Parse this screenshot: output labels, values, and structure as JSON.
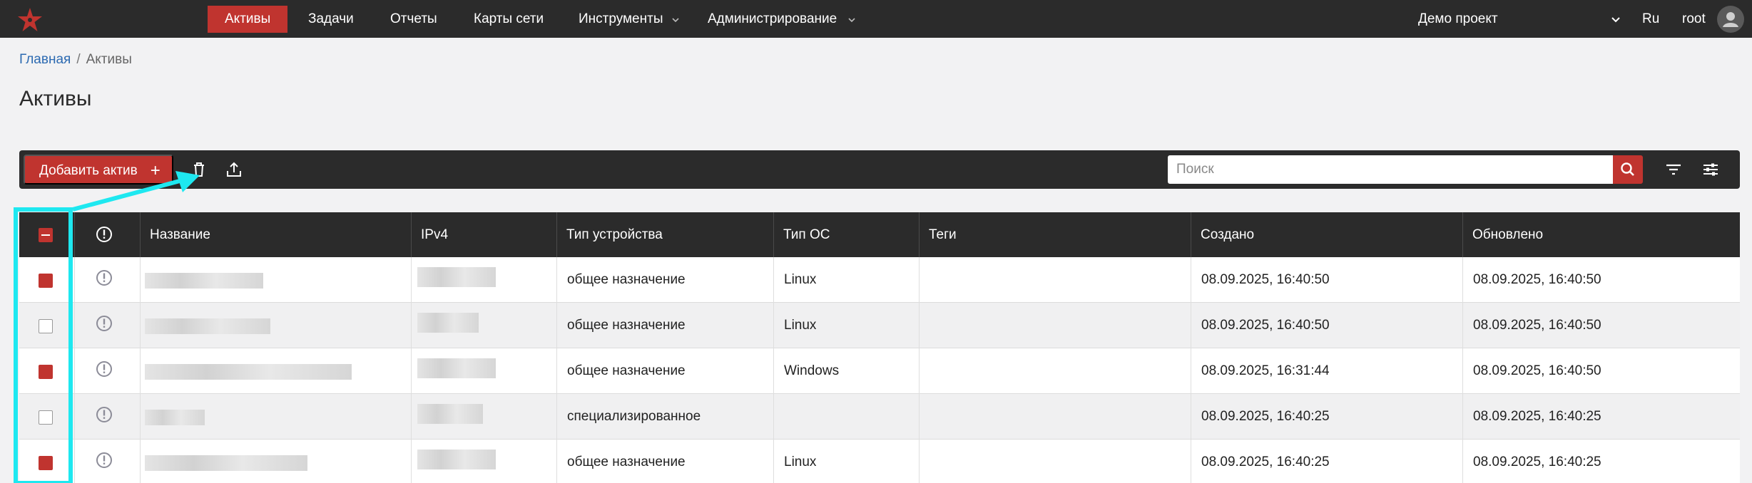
{
  "nav": {
    "items": [
      {
        "label": "Активы",
        "active": true
      },
      {
        "label": "Задачи"
      },
      {
        "label": "Отчеты"
      },
      {
        "label": "Карты сети"
      },
      {
        "label": "Инструменты",
        "dropdown": true
      },
      {
        "label": "Администрирование",
        "dropdown": true
      }
    ],
    "project": "Демо проект",
    "lang": "Ru",
    "user": "root"
  },
  "breadcrumb": {
    "home": "Главная",
    "separator": "/",
    "current": "Активы"
  },
  "page_title": "Активы",
  "toolbar": {
    "add_label": "Добавить актив",
    "add_plus": "+",
    "search_placeholder": "Поиск"
  },
  "table": {
    "columns": [
      "Название",
      "IPv4",
      "Тип устройства",
      "Тип ОС",
      "Теги",
      "Создано",
      "Обновлено"
    ],
    "rows": [
      {
        "checked": true,
        "device": "общее назначение",
        "os": "Linux",
        "tags": "",
        "created": "08.09.2025, 16:40:50",
        "updated": "08.09.2025, 16:40:50"
      },
      {
        "checked": false,
        "device": "общее назначение",
        "os": "Linux",
        "tags": "",
        "created": "08.09.2025, 16:40:50",
        "updated": "08.09.2025, 16:40:50"
      },
      {
        "checked": true,
        "device": "общее назначение",
        "os": "Windows",
        "tags": "",
        "created": "08.09.2025, 16:31:44",
        "updated": "08.09.2025, 16:40:50"
      },
      {
        "checked": false,
        "device": "специализированное",
        "os": "",
        "tags": "",
        "created": "08.09.2025, 16:40:25",
        "updated": "08.09.2025, 16:40:25"
      },
      {
        "checked": true,
        "device": "общее назначение",
        "os": "Linux",
        "tags": "",
        "created": "08.09.2025, 16:40:25",
        "updated": "08.09.2025, 16:40:25"
      }
    ]
  },
  "colors": {
    "accent": "#c0342f",
    "dark": "#2b2b2b",
    "highlight": "#1ee8f0",
    "link": "#2c6ab1"
  }
}
